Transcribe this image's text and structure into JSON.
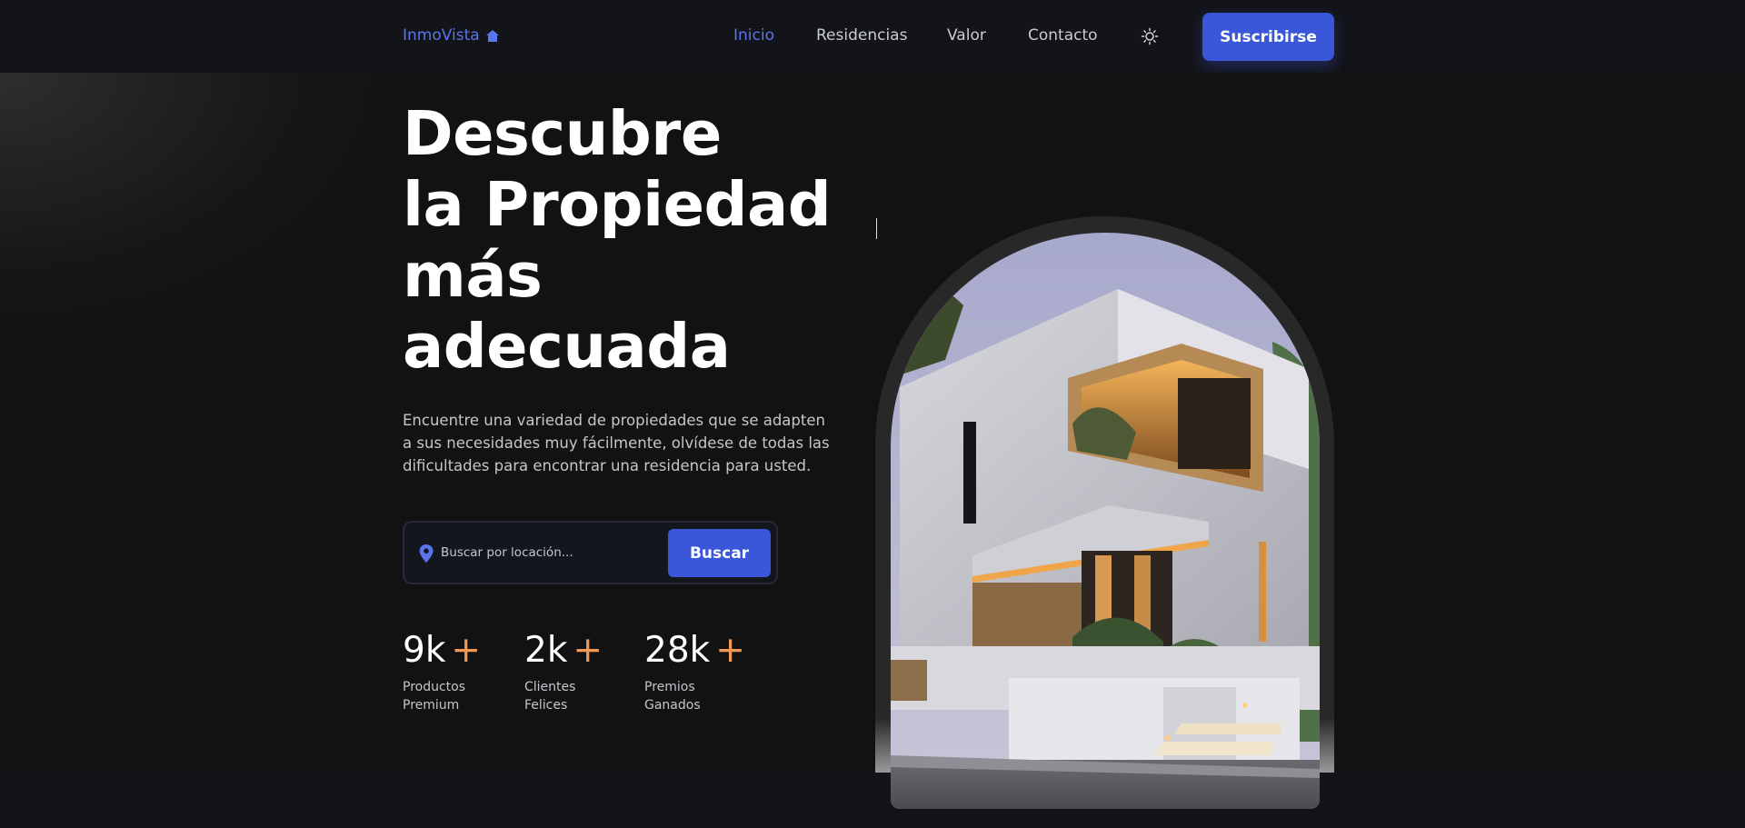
{
  "header": {
    "logo_text": "InmoVista",
    "nav": [
      {
        "label": "Inicio",
        "active": true
      },
      {
        "label": "Residencias",
        "active": false
      },
      {
        "label": "Valor",
        "active": false
      },
      {
        "label": "Contacto",
        "active": false
      }
    ],
    "theme_icon": "sun-icon",
    "subscribe_label": "Suscribirse"
  },
  "hero": {
    "title_lines": [
      "Descubre",
      "la Propiedad",
      "más",
      "adecuada"
    ],
    "description": "Encuentre una variedad de propiedades que se adapten a sus necesidades muy fácilmente, olvídese de todas las dificultades para encontrar una residencia para usted.",
    "search": {
      "placeholder": "Buscar por locación...",
      "button_label": "Buscar",
      "icon": "location-pin-icon"
    },
    "stats": [
      {
        "value": "9k",
        "plus": "+",
        "label": "Productos Premium"
      },
      {
        "value": "2k",
        "plus": "+",
        "label": "Clientes Felices"
      },
      {
        "value": "28k",
        "plus": "+",
        "label": "Premios Ganados"
      }
    ]
  },
  "colors": {
    "accent": "#3a57d9",
    "link_active": "#5a74ec",
    "plus": "#f29a55",
    "background": "#121317"
  }
}
